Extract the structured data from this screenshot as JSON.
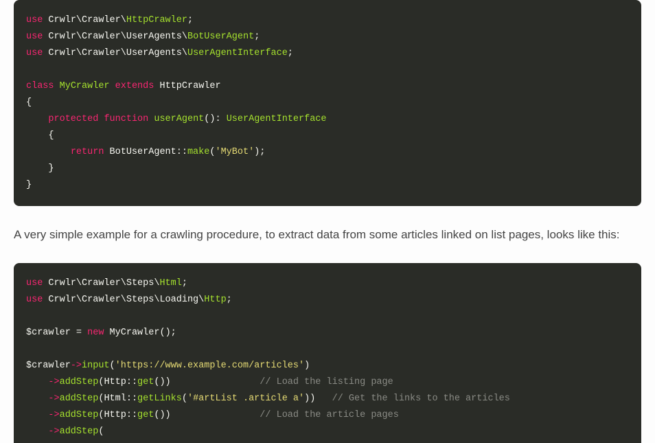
{
  "code1": {
    "l1_use": "use",
    "l1_ns": "Crwlr\\Crawler\\",
    "l1_cls": "HttpCrawler",
    "l2_use": "use",
    "l2_ns": "Crwlr\\Crawler\\UserAgents\\",
    "l2_cls": "BotUserAgent",
    "l3_use": "use",
    "l3_ns": "Crwlr\\Crawler\\UserAgents\\",
    "l3_cls": "UserAgentInterface",
    "kw_class": "class",
    "my_crawler": "MyCrawler",
    "kw_extends": "extends",
    "http_crawler": "HttpCrawler",
    "brace_open": "{",
    "kw_protected": "protected",
    "kw_function": "function",
    "fn_userAgent": "userAgent",
    "ret_type": "UserAgentInterface",
    "brace_open2": "{",
    "kw_return": "return",
    "bot_ua": "BotUserAgent",
    "dcolon": "::",
    "fn_make": "make",
    "str_mybot": "'MyBot'",
    "brace_close2": "}",
    "brace_close": "}"
  },
  "para": "A very simple example for a crawling procedure, to extract data from some articles linked on list pages, looks like this:",
  "code2": {
    "l1_use": "use",
    "l1_ns": "Crwlr\\Crawler\\Steps\\",
    "l1_cls": "Html",
    "l2_use": "use",
    "l2_ns": "Crwlr\\Crawler\\Steps\\Loading\\",
    "l2_cls": "Http",
    "var_crawler": "$crawler",
    "eq": " = ",
    "kw_new": "new",
    "my_crawler": "MyCrawler",
    "var_crawler2": "$crawler",
    "arrow": "->",
    "fn_input": "input",
    "str_url": "'https://www.example.com/articles'",
    "fn_addStep": "addStep",
    "cls_http": "Http",
    "dcolon": "::",
    "fn_get": "get",
    "c1": "// Load the listing page",
    "cls_html": "Html",
    "fn_getLinks": "getLinks",
    "str_sel": "'#artList .article a'",
    "c2": "// Get the links to the articles",
    "c3": "// Load the article pages"
  }
}
